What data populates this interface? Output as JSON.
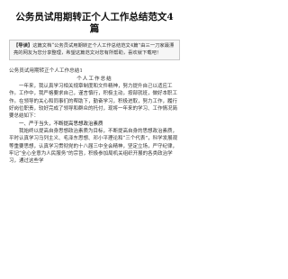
{
  "document": {
    "title_line1": "公务员试用期转正个人工作总结范文4",
    "title_line2": "篇",
    "guide_tag": "【导读】",
    "guide_text": "这篇文档“公务员试用期转正个人工作总结范文4篇”由三一刀家最漂亮的网友为您分享整理，希望这篇范文对您有所帮助，喜欢就下载吧！",
    "subheading": "公务员试用期转正个人工作总结1",
    "center_heading": "个人工作总结",
    "paragraph1": "一年来，我认真学习相关规章制度和文件精神，努力提升自己以适应工作。工作中，我严格要求自己，谨言慎行，积极主动，按部就班，做好本职工作。在领导的关心和同事们的帮助下，勤奋学习，积极进取，努力工作，履行好岗位职责，较好完成了领导和群众的托付，现将一年来的学习、工作情况简要总结如下：",
    "section1": "一、严于当头，不断提高思想政治素质",
    "paragraph2": "我始终以提高自身思想政治素质为目标，不断提高自身的思想政治素质，平时认真学习马列主义、毛泽东思想、邓小平理论和“三个代表”，科学发展观等重要思想，认真学习贯彻党的十八届三中全会精神，坚定立场，严守纪律，牢记“全心全意为人民服务”的宗旨，积极参加局机关组织开展的各类政治学习，通过这些学"
  }
}
